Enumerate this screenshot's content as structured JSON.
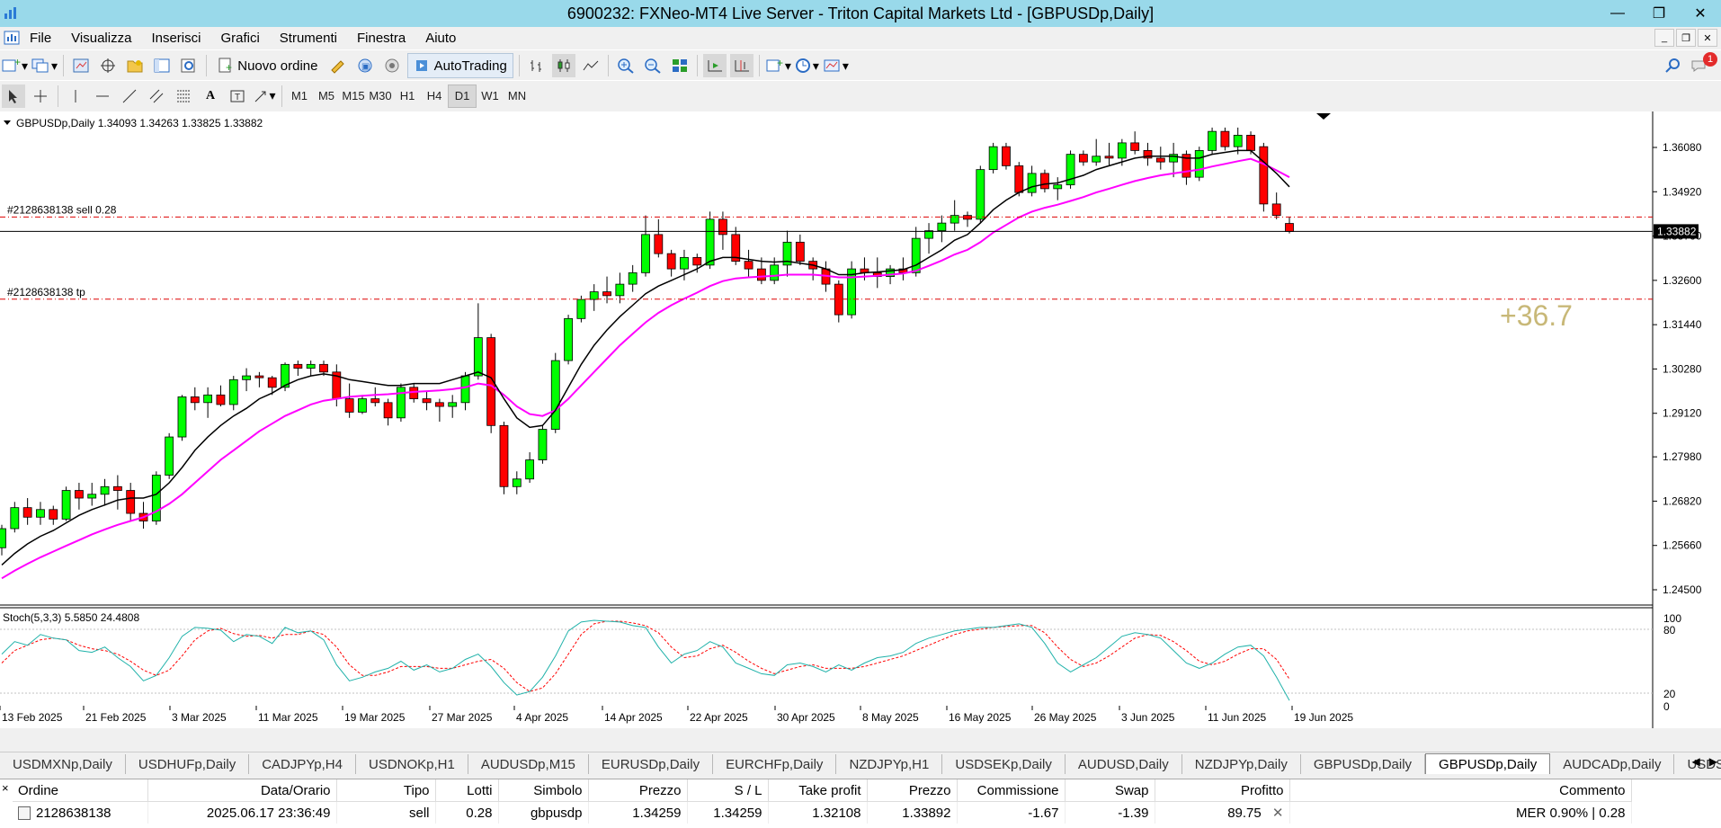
{
  "window": {
    "title": "6900232: FXNeo-MT4 Live Server - Triton Capital Markets Ltd - [GBPUSDp,Daily]",
    "minimize": "—",
    "maximize": "❐",
    "close": "✕"
  },
  "menu": {
    "items": [
      "File",
      "Visualizza",
      "Inserisci",
      "Grafici",
      "Strumenti",
      "Finestra",
      "Aiuto"
    ]
  },
  "toolbar": {
    "new_order_label": "Nuovo ordine",
    "autotrading_label": "AutoTrading",
    "notification_count": "1"
  },
  "timeframes": [
    "M1",
    "M5",
    "M15",
    "M30",
    "H1",
    "H4",
    "D1",
    "W1",
    "MN"
  ],
  "active_timeframe": "D1",
  "chart": {
    "header": "GBPUSDp,Daily  1.34093 1.34263 1.33825 1.33882",
    "current_price": "1.33882",
    "order_line_label": "#2128638138 sell 0.28",
    "tp_line_label": "#2128638138 tp",
    "profit_overlay": "+36.7",
    "y_ticks": [
      "1.36080",
      "1.34920",
      "1.33760",
      "1.32600",
      "1.31440",
      "1.30280",
      "1.29120",
      "1.27980",
      "1.26820",
      "1.25660",
      "1.24500"
    ],
    "stoch_label": "Stoch(5,3,3) 5.5850 24.4808",
    "stoch_ticks": [
      "100",
      "80",
      "20",
      "0"
    ],
    "x_labels": [
      "13 Feb 2025",
      "21 Feb 2025",
      "3 Mar 2025",
      "11 Mar 2025",
      "19 Mar 2025",
      "27 Mar 2025",
      "4 Apr 2025",
      "14 Apr 2025",
      "22 Apr 2025",
      "30 Apr 2025",
      "8 May 2025",
      "16 May 2025",
      "26 May 2025",
      "3 Jun 2025",
      "11 Jun 2025",
      "19 Jun 2025"
    ],
    "colors": {
      "bull": "#00ff00",
      "bear": "#ff0000",
      "ma_fast": "#000000",
      "ma_slow": "#ff00ff",
      "stoch_main": "#20b2aa",
      "stoch_signal": "#ff0000",
      "profit": "#c8b878"
    }
  },
  "chart_data": {
    "type": "candlestick",
    "symbol": "GBPUSDp",
    "timeframe": "Daily",
    "ylim": [
      1.245,
      1.3665
    ],
    "order_price": 1.34259,
    "take_profit": 1.32108,
    "candles": [
      [
        1.256,
        1.262,
        1.254,
        1.261
      ],
      [
        1.261,
        1.268,
        1.26,
        1.2665
      ],
      [
        1.2665,
        1.269,
        1.262,
        1.264
      ],
      [
        1.264,
        1.268,
        1.262,
        1.266
      ],
      [
        1.266,
        1.267,
        1.262,
        1.2635
      ],
      [
        1.2635,
        1.272,
        1.263,
        1.271
      ],
      [
        1.271,
        1.273,
        1.266,
        1.269
      ],
      [
        1.269,
        1.273,
        1.267,
        1.27
      ],
      [
        1.27,
        1.274,
        1.267,
        1.272
      ],
      [
        1.272,
        1.275,
        1.266,
        1.271
      ],
      [
        1.271,
        1.273,
        1.263,
        1.265
      ],
      [
        1.265,
        1.268,
        1.261,
        1.263
      ],
      [
        1.263,
        1.276,
        1.262,
        1.275
      ],
      [
        1.275,
        1.286,
        1.274,
        1.285
      ],
      [
        1.285,
        1.296,
        1.284,
        1.2955
      ],
      [
        1.2955,
        1.298,
        1.292,
        1.294
      ],
      [
        1.294,
        1.298,
        1.29,
        1.296
      ],
      [
        1.296,
        1.2985,
        1.293,
        1.2935
      ],
      [
        1.2935,
        1.301,
        1.292,
        1.3
      ],
      [
        1.3,
        1.303,
        1.297,
        1.301
      ],
      [
        1.301,
        1.302,
        1.298,
        1.3005
      ],
      [
        1.3005,
        1.301,
        1.296,
        1.298
      ],
      [
        1.298,
        1.3045,
        1.297,
        1.304
      ],
      [
        1.304,
        1.305,
        1.301,
        1.303
      ],
      [
        1.303,
        1.305,
        1.301,
        1.304
      ],
      [
        1.304,
        1.305,
        1.301,
        1.302
      ],
      [
        1.302,
        1.304,
        1.293,
        1.295
      ],
      [
        1.295,
        1.299,
        1.29,
        1.2915
      ],
      [
        1.2915,
        1.296,
        1.291,
        1.295
      ],
      [
        1.295,
        1.298,
        1.293,
        1.294
      ],
      [
        1.294,
        1.295,
        1.288,
        1.29
      ],
      [
        1.29,
        1.299,
        1.289,
        1.298
      ],
      [
        1.298,
        1.299,
        1.294,
        1.295
      ],
      [
        1.295,
        1.297,
        1.292,
        1.294
      ],
      [
        1.294,
        1.295,
        1.289,
        1.293
      ],
      [
        1.293,
        1.296,
        1.29,
        1.294
      ],
      [
        1.294,
        1.302,
        1.292,
        1.301
      ],
      [
        1.301,
        1.32,
        1.3,
        1.311
      ],
      [
        1.311,
        1.312,
        1.286,
        1.288
      ],
      [
        1.288,
        1.289,
        1.27,
        1.272
      ],
      [
        1.272,
        1.276,
        1.27,
        1.274
      ],
      [
        1.274,
        1.281,
        1.273,
        1.279
      ],
      [
        1.279,
        1.288,
        1.278,
        1.287
      ],
      [
        1.287,
        1.307,
        1.286,
        1.305
      ],
      [
        1.305,
        1.317,
        1.304,
        1.316
      ],
      [
        1.316,
        1.322,
        1.315,
        1.321
      ],
      [
        1.321,
        1.325,
        1.318,
        1.323
      ],
      [
        1.323,
        1.327,
        1.32,
        1.322
      ],
      [
        1.322,
        1.328,
        1.32,
        1.325
      ],
      [
        1.325,
        1.33,
        1.323,
        1.328
      ],
      [
        1.328,
        1.343,
        1.327,
        1.338
      ],
      [
        1.338,
        1.342,
        1.332,
        1.333
      ],
      [
        1.333,
        1.334,
        1.327,
        1.329
      ],
      [
        1.329,
        1.334,
        1.326,
        1.332
      ],
      [
        1.332,
        1.333,
        1.328,
        1.33
      ],
      [
        1.33,
        1.344,
        1.329,
        1.342
      ],
      [
        1.342,
        1.344,
        1.334,
        1.338
      ],
      [
        1.338,
        1.34,
        1.33,
        1.331
      ],
      [
        1.331,
        1.334,
        1.327,
        1.329
      ],
      [
        1.329,
        1.332,
        1.325,
        1.326
      ],
      [
        1.326,
        1.332,
        1.325,
        1.33
      ],
      [
        1.33,
        1.339,
        1.327,
        1.336
      ],
      [
        1.336,
        1.338,
        1.33,
        1.331
      ],
      [
        1.331,
        1.332,
        1.326,
        1.329
      ],
      [
        1.329,
        1.331,
        1.323,
        1.325
      ],
      [
        1.325,
        1.326,
        1.315,
        1.317
      ],
      [
        1.317,
        1.331,
        1.316,
        1.329
      ],
      [
        1.329,
        1.332,
        1.326,
        1.328
      ],
      [
        1.328,
        1.332,
        1.324,
        1.327
      ],
      [
        1.327,
        1.33,
        1.325,
        1.329
      ],
      [
        1.329,
        1.332,
        1.326,
        1.328
      ],
      [
        1.328,
        1.34,
        1.327,
        1.337
      ],
      [
        1.337,
        1.341,
        1.333,
        1.339
      ],
      [
        1.339,
        1.343,
        1.336,
        1.341
      ],
      [
        1.341,
        1.347,
        1.339,
        1.343
      ],
      [
        1.343,
        1.344,
        1.34,
        1.342
      ],
      [
        1.342,
        1.356,
        1.341,
        1.355
      ],
      [
        1.355,
        1.362,
        1.354,
        1.361
      ],
      [
        1.361,
        1.362,
        1.355,
        1.356
      ],
      [
        1.356,
        1.357,
        1.348,
        1.349
      ],
      [
        1.349,
        1.356,
        1.348,
        1.354
      ],
      [
        1.354,
        1.355,
        1.349,
        1.35
      ],
      [
        1.35,
        1.353,
        1.347,
        1.351
      ],
      [
        1.351,
        1.36,
        1.35,
        1.359
      ],
      [
        1.359,
        1.36,
        1.356,
        1.357
      ],
      [
        1.357,
        1.363,
        1.356,
        1.3585
      ],
      [
        1.3585,
        1.362,
        1.356,
        1.358
      ],
      [
        1.358,
        1.363,
        1.356,
        1.362
      ],
      [
        1.362,
        1.365,
        1.359,
        1.36
      ],
      [
        1.36,
        1.362,
        1.356,
        1.358
      ],
      [
        1.358,
        1.361,
        1.355,
        1.357
      ],
      [
        1.357,
        1.362,
        1.353,
        1.359
      ],
      [
        1.359,
        1.36,
        1.351,
        1.353
      ],
      [
        1.353,
        1.361,
        1.352,
        1.36
      ],
      [
        1.36,
        1.366,
        1.359,
        1.365
      ],
      [
        1.365,
        1.366,
        1.36,
        1.361
      ],
      [
        1.361,
        1.366,
        1.359,
        1.364
      ],
      [
        1.364,
        1.365,
        1.359,
        1.36
      ],
      [
        1.361,
        1.362,
        1.344,
        1.346
      ],
      [
        1.346,
        1.349,
        1.342,
        1.343
      ],
      [
        1.3409,
        1.3426,
        1.3383,
        1.3388
      ]
    ],
    "ma_fast": [
      1.2515,
      1.2545,
      1.257,
      1.259,
      1.2605,
      1.2625,
      1.2645,
      1.266,
      1.2672,
      1.2685,
      1.269,
      1.269,
      1.27,
      1.273,
      1.277,
      1.2815,
      1.285,
      1.288,
      1.2905,
      1.2925,
      1.295,
      1.2965,
      1.2985,
      1.3,
      1.301,
      1.3015,
      1.301,
      1.3,
      1.2995,
      1.299,
      1.2985,
      1.2985,
      1.299,
      1.299,
      1.299,
      1.3,
      1.301,
      1.302,
      1.3005,
      1.295,
      1.29,
      1.2875,
      1.288,
      1.292,
      1.298,
      1.304,
      1.309,
      1.313,
      1.3165,
      1.3195,
      1.3225,
      1.3245,
      1.326,
      1.3275,
      1.329,
      1.331,
      1.332,
      1.332,
      1.3315,
      1.331,
      1.3308,
      1.331,
      1.3305,
      1.33,
      1.329,
      1.3275,
      1.3275,
      1.328,
      1.3282,
      1.3285,
      1.3288,
      1.33,
      1.332,
      1.334,
      1.3365,
      1.338,
      1.341,
      1.3445,
      1.347,
      1.349,
      1.3505,
      1.3512,
      1.3515,
      1.3525,
      1.3535,
      1.355,
      1.356,
      1.357,
      1.358,
      1.3585,
      1.3585,
      1.3585,
      1.358,
      1.358,
      1.359,
      1.3595,
      1.36,
      1.36,
      1.357,
      1.354,
      1.3505
    ],
    "ma_slow": [
      1.248,
      1.25,
      1.2518,
      1.2535,
      1.255,
      1.2565,
      1.258,
      1.2595,
      1.2608,
      1.262,
      1.263,
      1.264,
      1.2655,
      1.2675,
      1.27,
      1.273,
      1.276,
      1.279,
      1.2815,
      1.284,
      1.2865,
      1.2885,
      1.2905,
      1.292,
      1.2935,
      1.2945,
      1.295,
      1.2955,
      1.2958,
      1.296,
      1.2962,
      1.2965,
      1.2968,
      1.297,
      1.2972,
      1.2975,
      1.298,
      1.299,
      1.2985,
      1.296,
      1.293,
      1.291,
      1.2905,
      1.292,
      1.295,
      1.2985,
      1.302,
      1.3055,
      1.309,
      1.312,
      1.315,
      1.3175,
      1.3195,
      1.3212,
      1.3228,
      1.3245,
      1.3258,
      1.3265,
      1.3268,
      1.327,
      1.3272,
      1.3275,
      1.3275,
      1.3275,
      1.3272,
      1.3268,
      1.3268,
      1.327,
      1.3272,
      1.3275,
      1.3278,
      1.3285,
      1.3298,
      1.3312,
      1.3328,
      1.334,
      1.336,
      1.3385,
      1.3405,
      1.3425,
      1.344,
      1.345,
      1.3458,
      1.3468,
      1.3478,
      1.349,
      1.35,
      1.351,
      1.352,
      1.3528,
      1.3535,
      1.354,
      1.3545,
      1.355,
      1.3558,
      1.3565,
      1.3572,
      1.3578,
      1.3565,
      1.3548,
      1.353
    ],
    "stoch_main": [
      58,
      72,
      68,
      80,
      76,
      74,
      62,
      60,
      66,
      54,
      44,
      28,
      34,
      54,
      78,
      88,
      87,
      85,
      72,
      80,
      78,
      70,
      88,
      82,
      84,
      74,
      46,
      28,
      32,
      38,
      42,
      50,
      40,
      46,
      38,
      42,
      52,
      58,
      44,
      26,
      12,
      16,
      32,
      56,
      84,
      94,
      96,
      95,
      94,
      90,
      88,
      66,
      48,
      58,
      62,
      72,
      66,
      48,
      42,
      36,
      34,
      46,
      48,
      44,
      38,
      46,
      40,
      48,
      54,
      56,
      60,
      70,
      76,
      80,
      84,
      86,
      88,
      88,
      90,
      92,
      88,
      70,
      48,
      38,
      46,
      54,
      66,
      78,
      82,
      80,
      76,
      62,
      48,
      42,
      48,
      58,
      66,
      68,
      56,
      32,
      6
    ],
    "stoch_signal": [
      48,
      62,
      68,
      74,
      76,
      74,
      68,
      64,
      62,
      58,
      50,
      40,
      34,
      40,
      56,
      74,
      84,
      87,
      81,
      78,
      79,
      76,
      80,
      80,
      84,
      80,
      66,
      46,
      34,
      34,
      38,
      44,
      44,
      44,
      42,
      42,
      46,
      50,
      52,
      42,
      26,
      16,
      20,
      36,
      58,
      80,
      92,
      95,
      95,
      93,
      90,
      82,
      66,
      54,
      56,
      64,
      68,
      60,
      50,
      42,
      36,
      40,
      44,
      46,
      42,
      42,
      42,
      44,
      48,
      52,
      56,
      62,
      68,
      74,
      80,
      84,
      86,
      88,
      89,
      90,
      90,
      82,
      66,
      52,
      44,
      48,
      56,
      66,
      76,
      80,
      79,
      72,
      62,
      50,
      46,
      50,
      58,
      64,
      64,
      52,
      30
    ]
  },
  "tabs": [
    "USDMXNp,Daily",
    "USDHUFp,Daily",
    "CADJPYp,H4",
    "USDNOKp,H1",
    "AUDUSDp,M15",
    "EURUSDp,Daily",
    "EURCHFp,Daily",
    "NZDJPYp,H1",
    "USDSEKp,Daily",
    "AUDUSD,Daily",
    "NZDJPYp,Daily",
    "GBPUSDp,Daily",
    "GBPUSDp,Daily",
    "AUDCADp,Daily",
    "USDSEKp,Dai"
  ],
  "active_tab_index": 12,
  "terminal": {
    "close_glyph": "×",
    "columns": [
      "Ordine",
      "Data/Orario",
      "Tipo",
      "Lotti",
      "Simbolo",
      "Prezzo",
      "S / L",
      "Take profit",
      "Prezzo",
      "Commissione",
      "Swap",
      "Profitto",
      "Commento"
    ],
    "rows": [
      [
        "2128638138",
        "2025.06.17 23:36:49",
        "sell",
        "0.28",
        "gbpusdp",
        "1.34259",
        "1.34259",
        "1.32108",
        "1.33892",
        "-1.67",
        "-1.39",
        "89.75",
        "MER 0.90% | 0.28"
      ]
    ]
  }
}
